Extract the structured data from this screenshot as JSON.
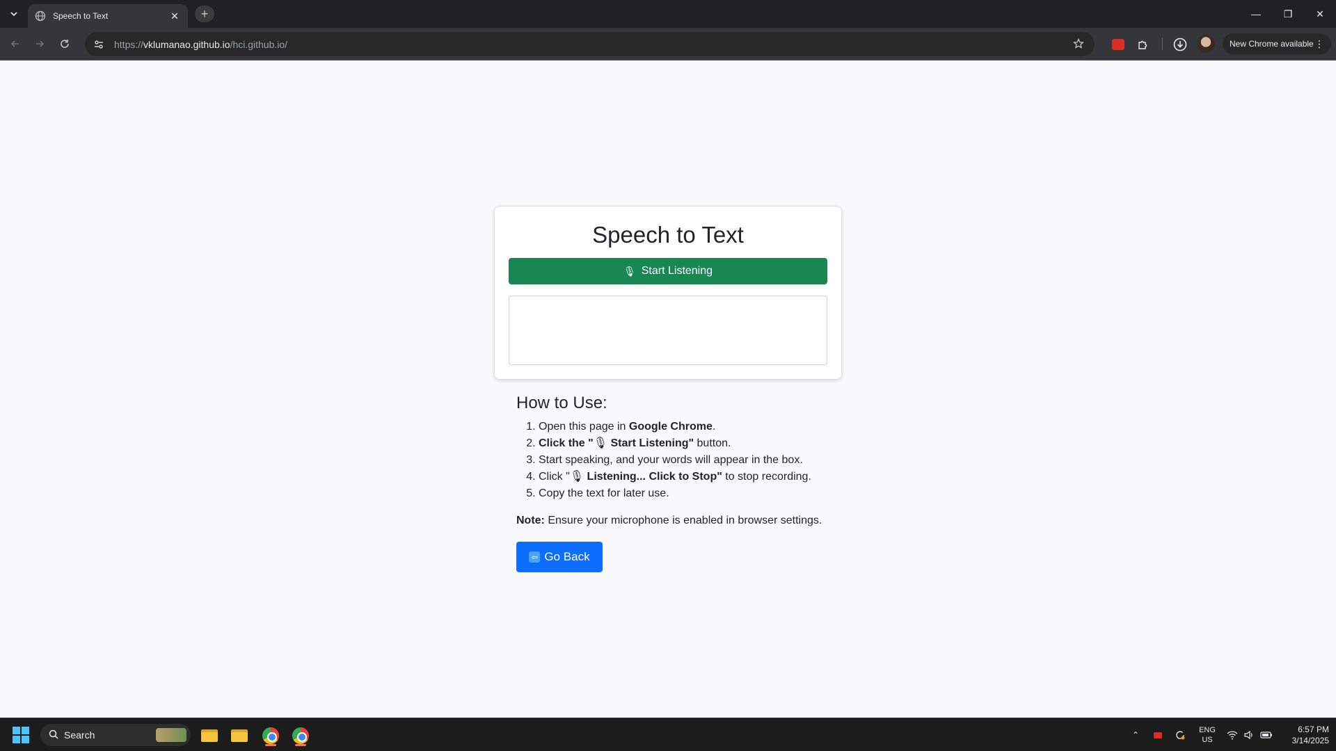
{
  "browser": {
    "tab_title": "Speech to Text",
    "url_scheme": "https://",
    "url_host": "vklumanao.github.io",
    "url_path": "/hci.github.io/",
    "update_label": "New Chrome available"
  },
  "page": {
    "title": "Speech to Text",
    "listen_button_label": "Start Listening",
    "listen_button_icon": "microphone-icon",
    "output_text": "",
    "howto_title": "How to Use:",
    "steps": [
      {
        "pre": "Open this page in ",
        "bold": "Google Chrome",
        "post": "."
      },
      {
        "pre": "Click the \"",
        "icon": "🎙",
        "bold": " Start Listening\"",
        "post": " button."
      },
      {
        "pre": "Start speaking, and your words will appear in the box.",
        "bold": "",
        "post": ""
      },
      {
        "pre": "Click \"",
        "icon": "🎙",
        "bold": " Listening... Click to Stop\"",
        "post": " to stop recording."
      },
      {
        "pre": "Copy the text for later use.",
        "bold": "",
        "post": ""
      }
    ],
    "note_label": "Note:",
    "note_text": " Ensure your microphone is enabled in browser settings.",
    "goback_label": "Go Back",
    "goback_icon": "arrow-left-icon"
  },
  "taskbar": {
    "search_placeholder": "Search",
    "lang_line1": "ENG",
    "lang_line2": "US",
    "time": "6:57 PM",
    "date": "3/14/2025"
  },
  "colors": {
    "listen_button": "#198754",
    "goback_button": "#0d6efd",
    "page_bg": "#f8f9fa"
  }
}
